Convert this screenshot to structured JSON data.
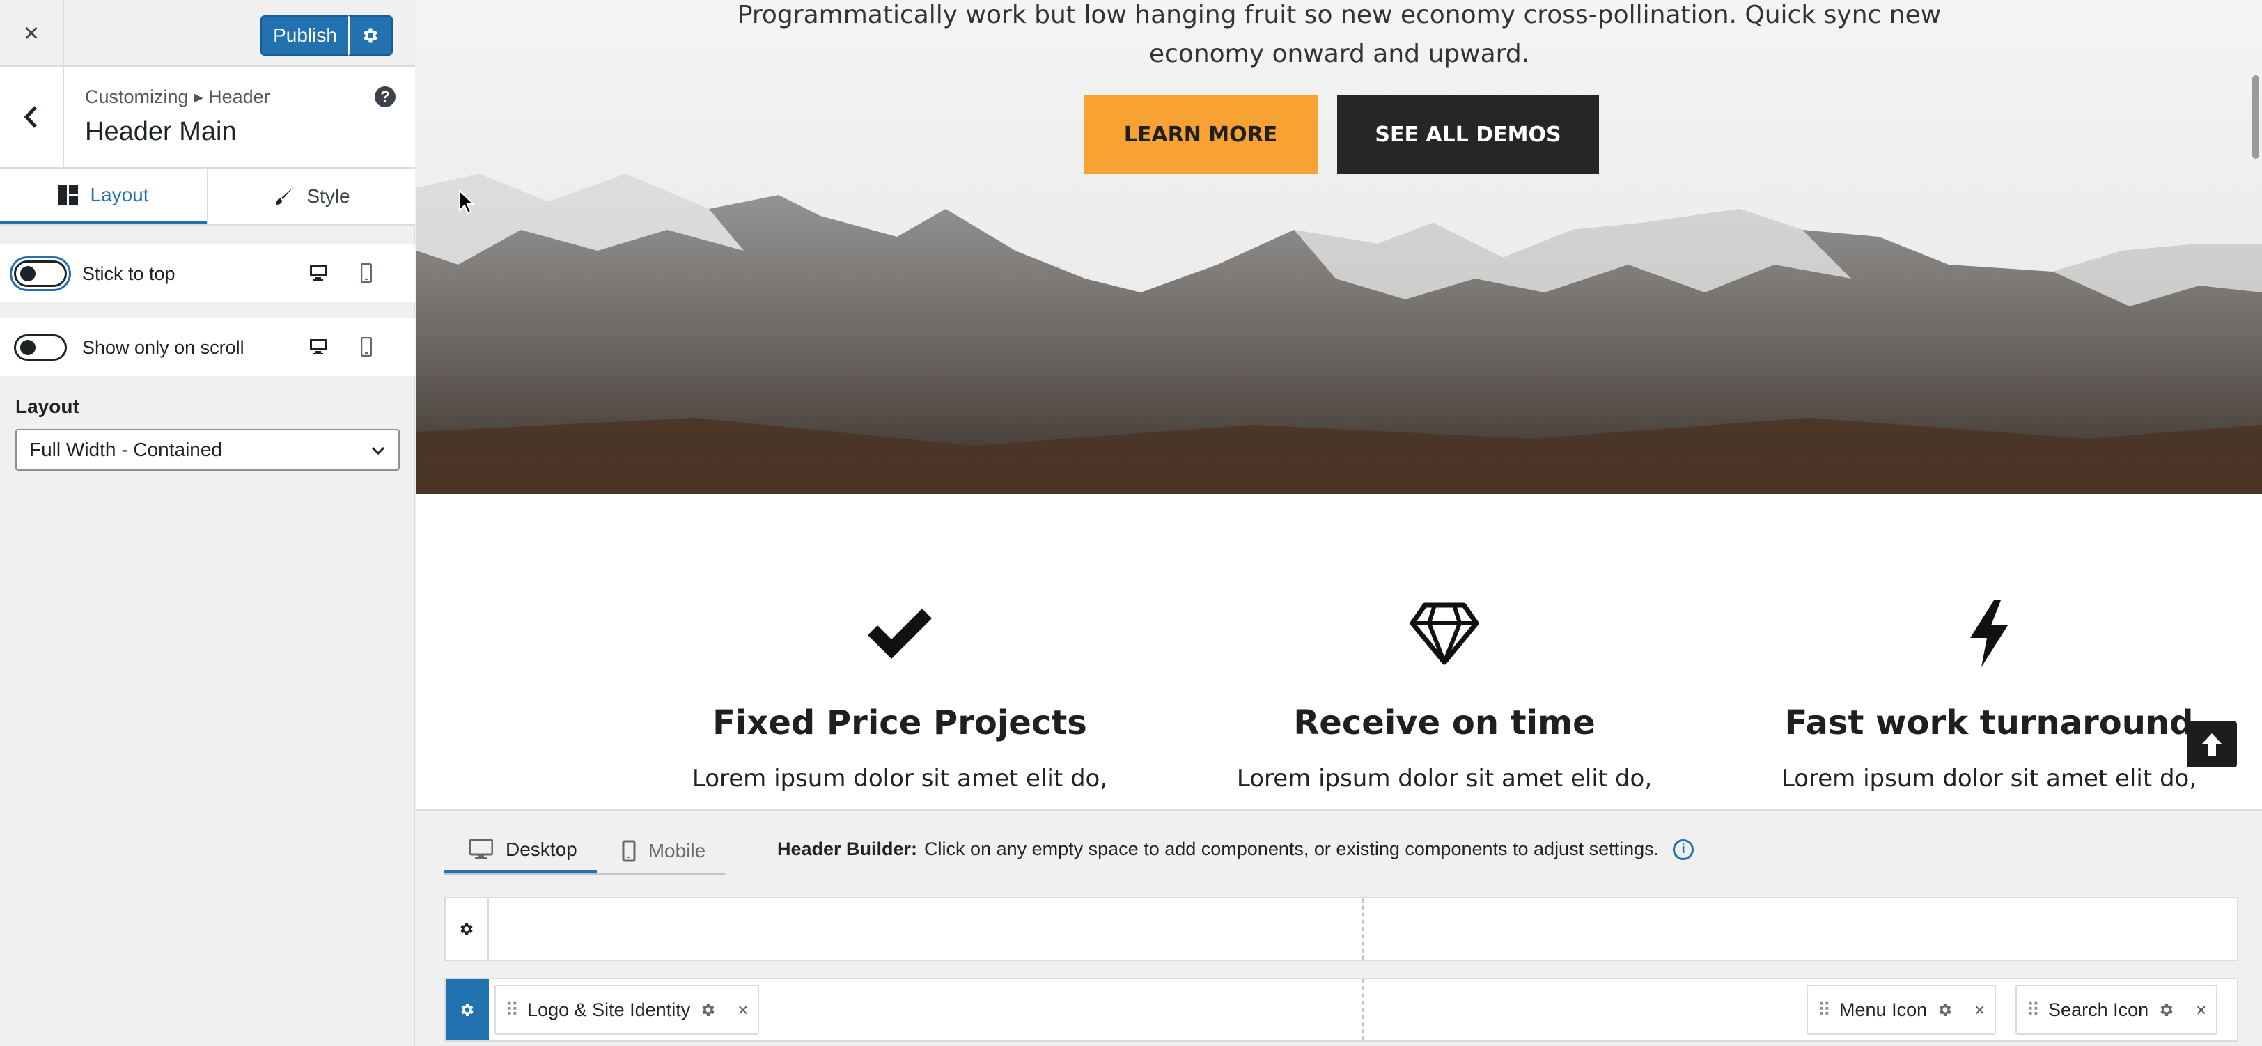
{
  "customizer": {
    "close_icon": "×",
    "publish_label": "Publish",
    "breadcrumb": "Customizing ▸ Header",
    "section_title": "Header Main",
    "help_icon": "?",
    "tabs": [
      {
        "label": "Layout",
        "icon": "layout-icon",
        "active": true
      },
      {
        "label": "Style",
        "icon": "brush-icon",
        "active": false
      }
    ],
    "toggles": [
      {
        "label": "Stick to top",
        "checked": false
      },
      {
        "label": "Show only on scroll",
        "checked": false
      }
    ],
    "layout_label": "Layout",
    "layout_value": "Full Width - Contained"
  },
  "preview": {
    "hero_line1": "Programmatically work but low hanging fruit so new economy cross-pollination. Quick sync new",
    "hero_line2": "economy onward and upward.",
    "learn_more_label": "LEARN MORE",
    "see_demos_label": "SEE ALL DEMOS",
    "features": [
      {
        "icon": "checkmark-icon",
        "title": "Fixed Price Projects",
        "text": "Lorem ipsum dolor sit amet elit do,"
      },
      {
        "icon": "diamond-icon",
        "title": "Receive on time",
        "text": "Lorem ipsum dolor sit amet elit do,"
      },
      {
        "icon": "lightning-icon",
        "title": "Fast work turnaround",
        "text": "Lorem ipsum dolor sit amet elit do,"
      }
    ],
    "colors": {
      "learn_more_bg": "#f8a233",
      "see_demos_bg": "#262626",
      "accent": "#2271b1"
    }
  },
  "builder": {
    "tabs": [
      {
        "label": "Desktop",
        "icon": "desktop-icon",
        "active": true
      },
      {
        "label": "Mobile",
        "icon": "mobile-icon",
        "active": false
      }
    ],
    "info_bold": "Header Builder:",
    "info_text": "Click on any empty space to add components, or existing components to adjust settings.",
    "info_icon": "i",
    "main_row_items": [
      {
        "label": "Logo & Site Identity"
      },
      {
        "label": "Menu Icon"
      },
      {
        "label": "Search Icon"
      }
    ]
  }
}
